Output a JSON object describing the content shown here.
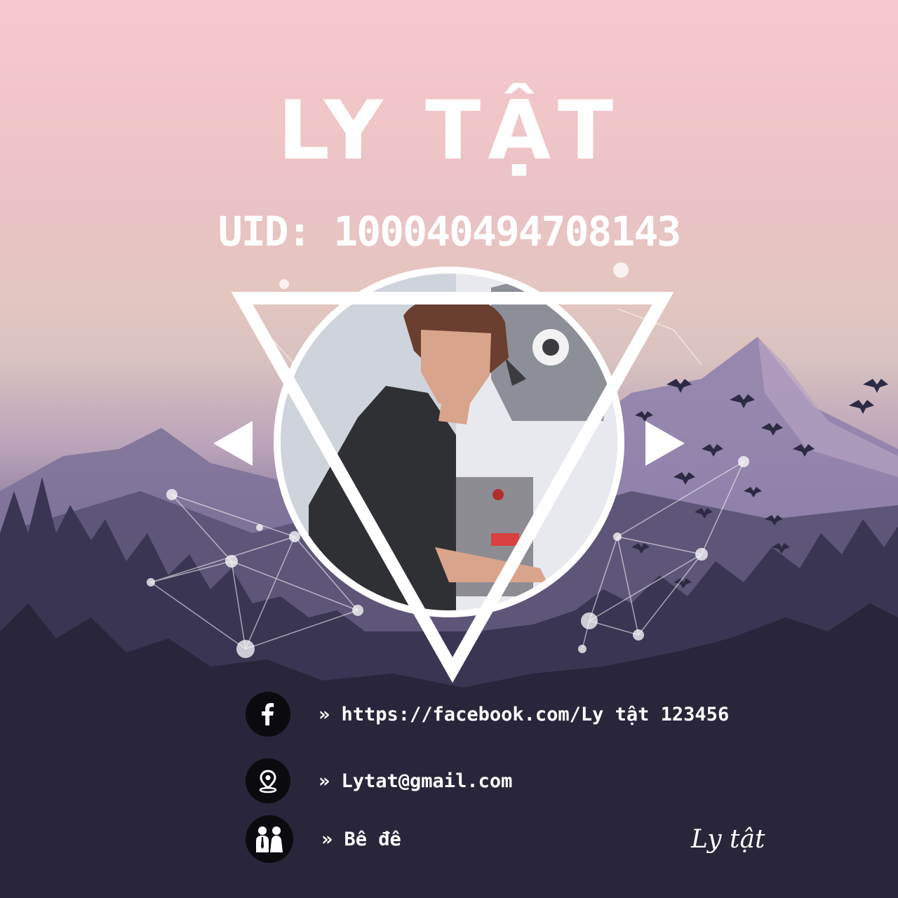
{
  "header": {
    "title": "LY TẬT",
    "uid": "UID: 100040494708143"
  },
  "profile": {
    "photo_alt": "profile photo"
  },
  "info": [
    {
      "icon": "facebook-icon",
      "text": "» https://facebook.com/Ly tật 123456"
    },
    {
      "icon": "location-pin-icon",
      "text": "» Lytat@gmail.com"
    },
    {
      "icon": "couple-icon",
      "text": "» Bê đê"
    }
  ],
  "signature": "Ly tật",
  "colors": {
    "sky_top": "#f6c9cf",
    "mountain": "#7a6f98",
    "forest": "#2c283f",
    "accent": "#ffffff"
  }
}
